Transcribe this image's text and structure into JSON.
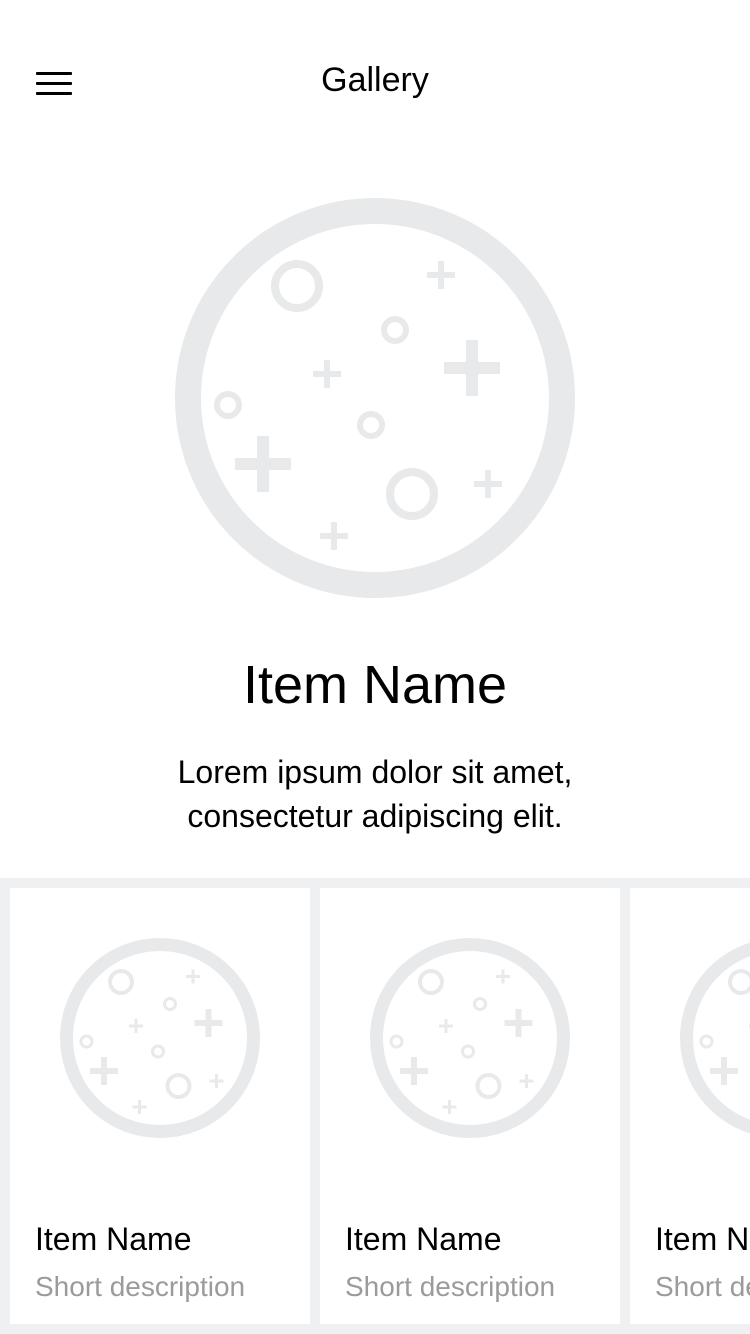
{
  "nav": {
    "title": "Gallery",
    "menu_icon": "hamburger-menu-icon"
  },
  "hero": {
    "image_icon": "placeholder-image-icon",
    "title": "Item Name",
    "description": "Lorem ipsum dolor sit amet,\nconsectetur  adipiscing elit."
  },
  "carousel": {
    "items": [
      {
        "title": "Item Name",
        "description": "Short description",
        "image_icon": "placeholder-image-icon"
      },
      {
        "title": "Item Name",
        "description": "Short description",
        "image_icon": "placeholder-image-icon"
      },
      {
        "title": "Item Name",
        "description": "Short description",
        "image_icon": "placeholder-image-icon"
      }
    ]
  },
  "colors": {
    "placeholder": "#e8e9eb",
    "carousel_background": "#eff0f1",
    "secondary_text": "#9b9b9b"
  }
}
